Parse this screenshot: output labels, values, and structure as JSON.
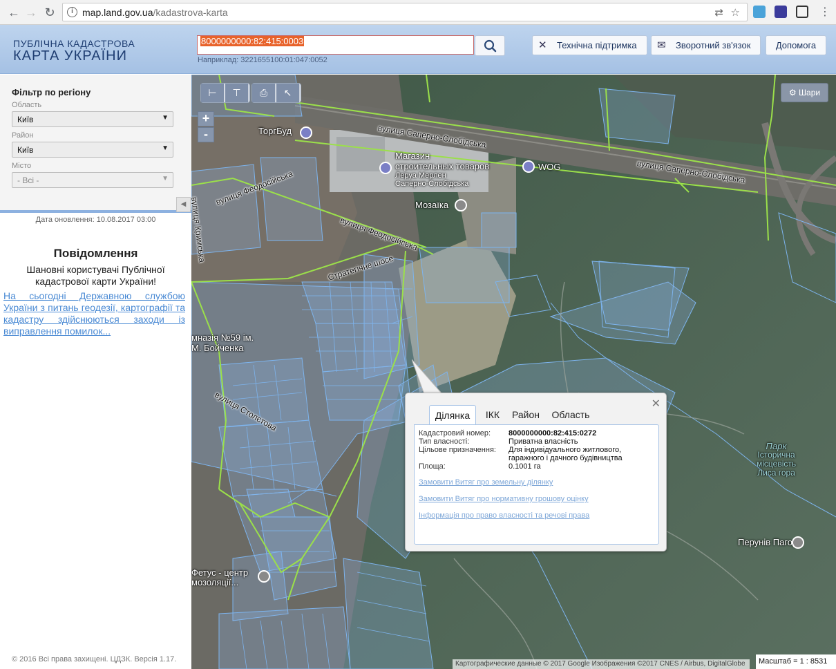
{
  "browser": {
    "url_host": "map.land.gov.ua",
    "url_path": "/kadastrova-karta"
  },
  "header": {
    "logo_line1": "ПУБЛІЧНА КАДАСТРОВА",
    "logo_line2": "КАРТА УКРАЇНИ",
    "search_value": "8000000000:82:415:0003",
    "search_hint": "Наприклад: 3221655100:01:047:0052",
    "buttons": {
      "support": "Технічна підтримка",
      "feedback": "Зворотний зв'язок",
      "help": "Допомога"
    }
  },
  "filter": {
    "title": "Фільтр по регіону",
    "oblast_label": "Область",
    "oblast_value": "Київ",
    "raion_label": "Район",
    "raion_value": "Київ",
    "misto_label": "Місто",
    "misto_value": "- Всі -"
  },
  "sidebar": {
    "updated": "Дата оновлення: 10.08.2017 03:00",
    "notice_title": "Повідомлення",
    "notice_text": "Шановні користувачі Публічної кадастрової карти України!",
    "notice_link": "На сьогодні Державною службою України з питань геодезії, картографії та кадастру здійснюються заходи із виправлення помилок...",
    "copyright": "© 2016 Всі права захищені. ЦДЗК. Версія 1.17."
  },
  "map": {
    "layers_button": "Шари",
    "zoom_in": "+",
    "zoom_out": "-",
    "labels": {
      "torgbud": "ТоргБуд",
      "store_l1": "Магазин",
      "store_l2": "строительных товаров",
      "store_l3": "Леруа Мерлен",
      "store_l4": "Саперно-Слобідська",
      "wog": "WOG",
      "mozaika": "Мозаїка",
      "street1": "вулиця Саперно-Слобідська",
      "street2": "вулиця Саперно-Слобідська",
      "street_feod1": "вулиця Феодосійська",
      "street_feod2": "вулиця Феодосійська",
      "strat": "Стратегічне шосе",
      "krymska": "вулиця Кримська",
      "stoletova": "вулиця Столєтова",
      "gymn_l1": "мназія №59 ім.",
      "gymn_l2": "М. Бойченка",
      "fetus_l1": "Фетус - центр",
      "fetus_l2": "мозоляції...",
      "park_l1": "Парк",
      "park_l2": "Історична",
      "park_l3": "місцевість",
      "park_l4": "Лиса гора",
      "perun": "Перунів Пагорб"
    },
    "attribution": "Картографические данные © 2017 Google Изображения ©2017 CNES / Airbus, DigitalGlobe",
    "scale": "Масштаб = 1 : 8531"
  },
  "popup": {
    "tabs": [
      "Ділянка",
      "ІКК",
      "Район",
      "Область"
    ],
    "cadastral_label": "Кадастровий номер:",
    "cadastral_value": "8000000000:82:415:0272",
    "ownership_label": "Тип власності:",
    "ownership_value": "Приватна власність",
    "purpose_label": "Цільове призначення:",
    "purpose_value": "Для індивідуального житлового, гаражного і дачного будівництва",
    "area_label": "Площа:",
    "area_value": "0.1001 га",
    "links": [
      "Замовити Витяг про земельну ділянку",
      "Замовити Витяг про нормативну грошову оцінку",
      "Інформація про право власності та речові права"
    ]
  }
}
